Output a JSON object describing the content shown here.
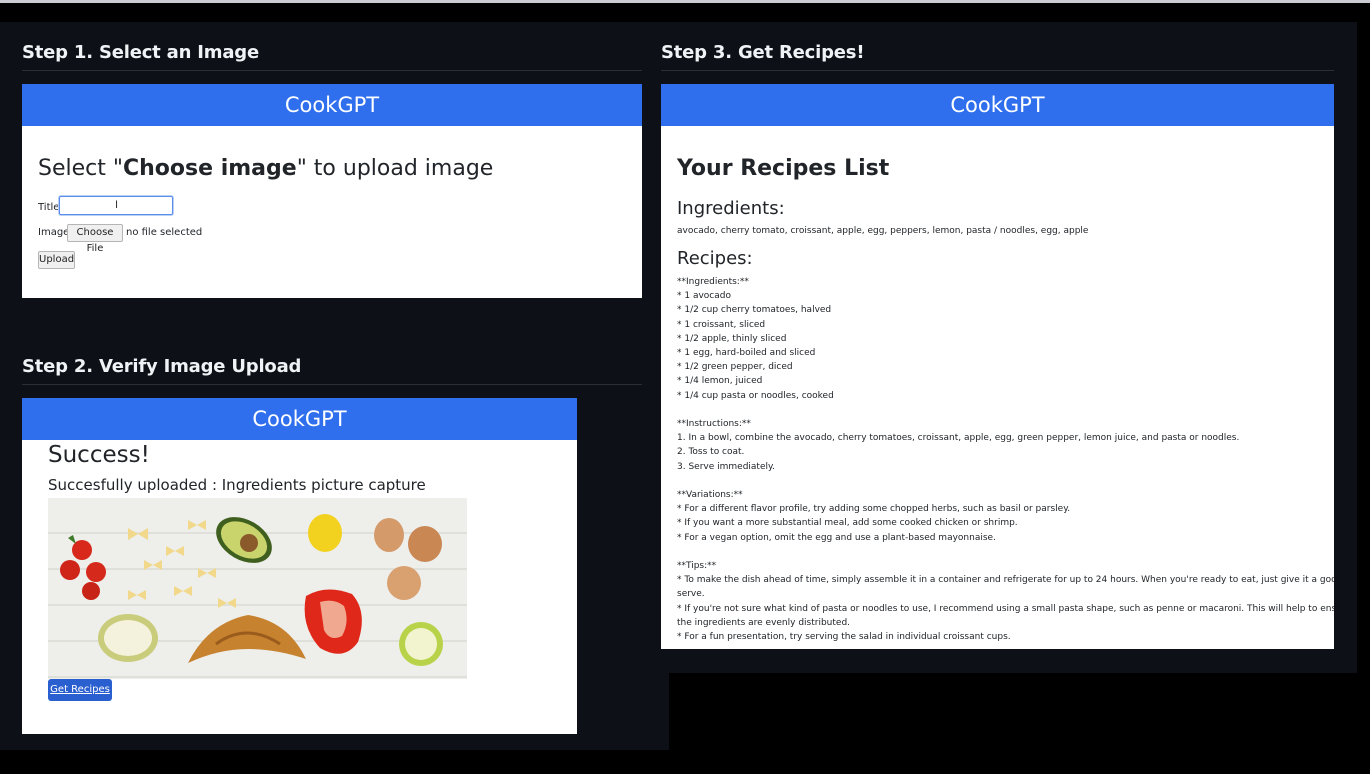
{
  "steps": {
    "step1": "Step 1. Select an Image",
    "step2": "Step 2. Verify Image Upload",
    "step3": "Step 3. Get Recipes!"
  },
  "brand": "CookGPT",
  "upload_page": {
    "heading_pre": "Select \"",
    "heading_bold": "Choose image",
    "heading_post": "\" to upload image",
    "title_label": "Title:",
    "title_value": "",
    "image_label": "Image:",
    "choose_file_label": "Choose File",
    "no_file_text": "no file selected",
    "upload_label": "Upload"
  },
  "verify_page": {
    "success": "Success!",
    "message": "Succesfully uploaded : Ingredients picture capture",
    "get_recipes_label": "Get Recipes"
  },
  "recipes_page": {
    "title": "Your Recipes List",
    "ingredients_heading": "Ingredients:",
    "ingredients": "avocado, cherry tomato, croissant, apple, egg, peppers, lemon, pasta / noodles, egg, apple",
    "recipes_heading": "Recipes:",
    "lines": [
      "**Ingredients:**",
      "* 1 avocado",
      "* 1/2 cup cherry tomatoes, halved",
      "* 1 croissant, sliced",
      "* 1/2 apple, thinly sliced",
      "* 1 egg, hard-boiled and sliced",
      "* 1/2 green pepper, diced",
      "* 1/4 lemon, juiced",
      "* 1/4 cup pasta or noodles, cooked",
      "",
      "**Instructions:**",
      "1. In a bowl, combine the avocado, cherry tomatoes, croissant, apple, egg, green pepper, lemon juice, and pasta or noodles.",
      "2. Toss to coat.",
      "3. Serve immediately.",
      "",
      "**Variations:**",
      "* For a different flavor profile, try adding some chopped herbs, such as basil or parsley.",
      "* If you want a more substantial meal, add some cooked chicken or shrimp.",
      "* For a vegan option, omit the egg and use a plant-based mayonnaise.",
      "",
      "**Tips:**",
      "* To make the dish ahead of time, simply assemble it in a container and refrigerate for up to 24 hours. When you're ready to eat, just give it a good stir and",
      "serve.",
      "* If you're not sure what kind of pasta or noodles to use, I recommend using a small pasta shape, such as penne or macaroni. This will help to ensure that",
      "the ingredients are evenly distributed.",
      "* For a fun presentation, try serving the salad in individual croissant cups."
    ]
  },
  "colors": {
    "brand_bar": "#2f6fee",
    "button_blue": "#2a5fd0",
    "panel_bg": "#0d1117"
  }
}
